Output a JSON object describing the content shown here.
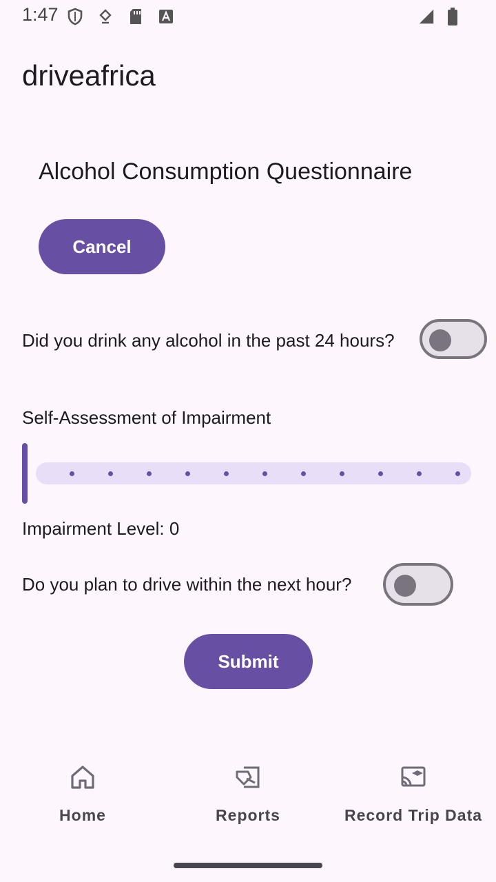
{
  "status_bar": {
    "time": "1:47",
    "icons": [
      "shield-icon",
      "download-icon",
      "sd-card-icon",
      "font-a-icon",
      "signal-icon",
      "battery-icon"
    ]
  },
  "app": {
    "title": "driveafrica"
  },
  "questionnaire": {
    "title": "Alcohol Consumption Questionnaire",
    "cancel_label": "Cancel",
    "q1_label": "Did you drink any alcohol in the past 24 hours?",
    "q1_value": false,
    "impairment_heading": "Self-Assessment of Impairment",
    "impairment_value": 0,
    "impairment_steps": 11,
    "impairment_level_label": "Impairment Level: 0",
    "q2_label": "Do you plan to drive within the next hour?",
    "q2_value": false,
    "submit_label": "Submit"
  },
  "bottom_nav": {
    "items": [
      {
        "label": "Home",
        "icon": "home-icon"
      },
      {
        "label": "Reports",
        "icon": "reports-icon"
      },
      {
        "label": "Record Trip Data",
        "icon": "record-trip-icon"
      }
    ]
  },
  "colors": {
    "background": "#fdf7fd",
    "primary": "#6750a4",
    "track": "#e8def8",
    "switch_outline": "#79747e"
  }
}
